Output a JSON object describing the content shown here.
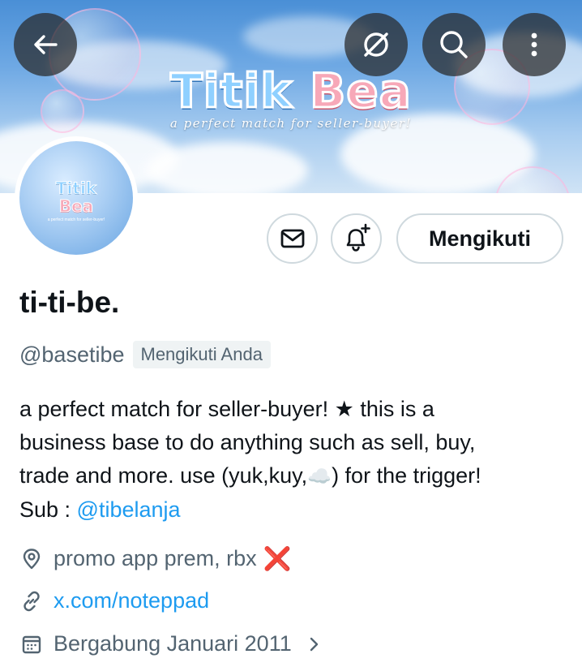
{
  "banner": {
    "brand_word1": "Titik",
    "brand_word2": "Bea",
    "tagline": "a perfect match for seller-buyer!"
  },
  "toolbar": {
    "back_icon": "arrow-left-icon",
    "grok_icon": "slashed-circle-icon",
    "search_icon": "search-icon",
    "more_icon": "more-vertical-icon"
  },
  "avatar": {
    "line1": "Titik",
    "line2": "Bea",
    "line3": "a perfect match for seller-buyer!"
  },
  "actions": {
    "message_icon": "envelope-icon",
    "notify_icon": "bell-plus-icon",
    "follow_label": "Mengikuti"
  },
  "profile": {
    "name": "ti-ti-be.",
    "handle": "@basetibe",
    "follows_you": "Mengikuti Anda",
    "bio_line1": "a perfect match for seller-buyer! ★ this is a",
    "bio_line2": "business base to do anything such as sell, buy,",
    "bio_line3_pre": "trade and more. use (yuk,kuy,",
    "bio_line3_emoji": "☁️",
    "bio_line3_post": ") for the trigger!",
    "sub_label": "Sub : ",
    "sub_link": "@tibelanja"
  },
  "meta": {
    "location": "promo app prem, rbx",
    "location_mark": "❌",
    "website": "x.com/noteppad",
    "joined": "Bergabung Januari 2011"
  },
  "colors": {
    "accent": "#1d9bf0",
    "muted": "#536471",
    "text": "#0f1419",
    "border": "#cfd9de"
  }
}
